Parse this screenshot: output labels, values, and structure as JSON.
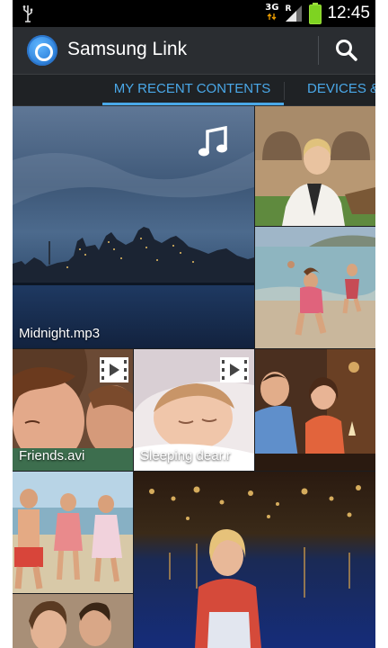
{
  "status_bar": {
    "network_top": "3G",
    "network_badge": "R",
    "time": "12:45",
    "icons": [
      "usb-icon",
      "data-arrows-icon",
      "signal-icon",
      "battery-icon"
    ]
  },
  "action_bar": {
    "app_name": "Samsung Link",
    "logo_icon": "samsung-link-logo",
    "search_icon": "search-icon"
  },
  "tabs": [
    {
      "label": "MY RECENT CONTENTS",
      "selected": true
    },
    {
      "label": "DEVICES &",
      "selected": false
    }
  ],
  "tiles": {
    "midnight": {
      "label": "Midnight.mp3",
      "type_icon": "music-note-icon"
    },
    "friends": {
      "label": "Friends.avi",
      "type_icon": "video-icon"
    },
    "sleeping": {
      "label": "Sleeping dear.r",
      "type_icon": "video-icon"
    }
  },
  "colors": {
    "accent": "#4aa8e8",
    "action_bar": "#2a2d31",
    "status_bar": "#000000",
    "background": "#1b1d20"
  }
}
